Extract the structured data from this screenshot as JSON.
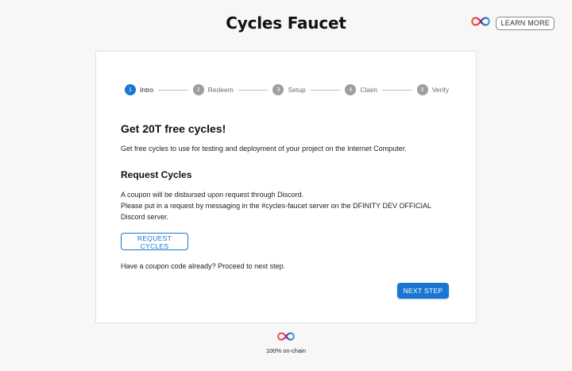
{
  "header": {
    "title": "Cycles Faucet",
    "learn_more_label": "LEARN MORE",
    "logo_icon": "infinity-logo-icon"
  },
  "colors": {
    "accent": "#1976d2",
    "inactive_step": "#9e9e9e",
    "background": "#f7f7f7"
  },
  "stepper": {
    "steps": [
      {
        "num": "1",
        "label": "Intro",
        "active": true
      },
      {
        "num": "2",
        "label": "Redeem",
        "active": false
      },
      {
        "num": "3",
        "label": "Setup",
        "active": false
      },
      {
        "num": "4",
        "label": "Claim",
        "active": false
      },
      {
        "num": "5",
        "label": "Verify",
        "active": false
      }
    ]
  },
  "content": {
    "heading": "Get 20T free cycles!",
    "intro_text": "Get free cycles to use for testing and deployment of your project on the Internet Computer.",
    "request_heading": "Request Cycles",
    "request_line1": "A coupon will be disbursed upon request through Discord.",
    "request_line2": "Please put in a request by messaging in the #cycles-faucet server on the DFINITY DEV OFFICIAL Discord server.",
    "request_button": "REQUEST CYCLES",
    "coupon_text": "Have a coupon code already? Proceed to next step.",
    "next_button": "NEXT STEP"
  },
  "footer": {
    "text": "100% on-chain",
    "logo_icon": "infinity-logo-icon"
  }
}
